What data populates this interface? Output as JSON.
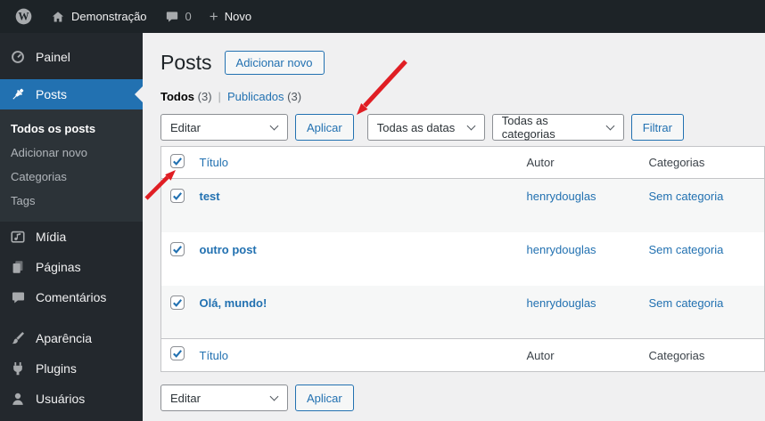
{
  "colors": {
    "accent_blue": "#2271b1",
    "link_blue": "#2271b1",
    "admin_bar_bg": "#1d2327",
    "sidebar_bg": "#23282d",
    "submenu_bg": "#2c3338",
    "page_bg": "#f0f0f1",
    "table_border": "#c3c4c7",
    "row_stripe": "#f6f7f7",
    "annotation_red": "#e01e24"
  },
  "admin_bar": {
    "wordpress_logo_icon": "wordpress-logo-icon",
    "home_icon": "home-icon",
    "site_name": "Demonstração",
    "comments_icon": "comment-bubble-icon",
    "comments_count": "0",
    "plus_icon": "plus-icon",
    "new_label": "Novo"
  },
  "sidebar": {
    "items": [
      {
        "label": "Painel",
        "icon": "dashboard-icon",
        "active": false
      },
      {
        "label": "Posts",
        "icon": "pushpin-icon",
        "active": true
      },
      {
        "label": "Mídia",
        "icon": "media-icon",
        "active": false
      },
      {
        "label": "Páginas",
        "icon": "pages-icon",
        "active": false
      },
      {
        "label": "Comentários",
        "icon": "comments-icon",
        "active": false
      },
      {
        "label": "Aparência",
        "icon": "appearance-brush-icon",
        "active": false
      },
      {
        "label": "Plugins",
        "icon": "plugin-icon",
        "active": false
      },
      {
        "label": "Usuários",
        "icon": "users-icon",
        "active": false
      }
    ],
    "posts_submenu": [
      {
        "label": "Todos os posts",
        "current": true
      },
      {
        "label": "Adicionar novo",
        "current": false
      },
      {
        "label": "Categorias",
        "current": false
      },
      {
        "label": "Tags",
        "current": false
      }
    ]
  },
  "main": {
    "page_title": "Posts",
    "add_new_button": "Adicionar novo",
    "views": {
      "all_label": "Todos",
      "all_count": "(3)",
      "separator": "|",
      "published_label": "Publicados",
      "published_count": "(3)"
    },
    "bulk_actions": {
      "selected": "Editar",
      "apply_button": "Aplicar"
    },
    "filters": {
      "dates_selected": "Todas as datas",
      "categories_selected": "Todas as categorias",
      "filter_button": "Filtrar"
    },
    "table": {
      "columns": {
        "title": "Título",
        "author": "Autor",
        "categories": "Categorias"
      },
      "rows": [
        {
          "title": "test",
          "author": "henrydouglas",
          "categories": "Sem categoria",
          "checked": true
        },
        {
          "title": "outro post",
          "author": "henrydouglas",
          "categories": "Sem categoria",
          "checked": true
        },
        {
          "title": "Olá, mundo!",
          "author": "henrydouglas",
          "categories": "Sem categoria",
          "checked": true
        }
      ],
      "select_all_checked": true
    }
  },
  "annotations": {
    "arrows": [
      {
        "name": "arrow-to-apply-button"
      },
      {
        "name": "arrow-to-select-all-checkbox"
      }
    ]
  }
}
